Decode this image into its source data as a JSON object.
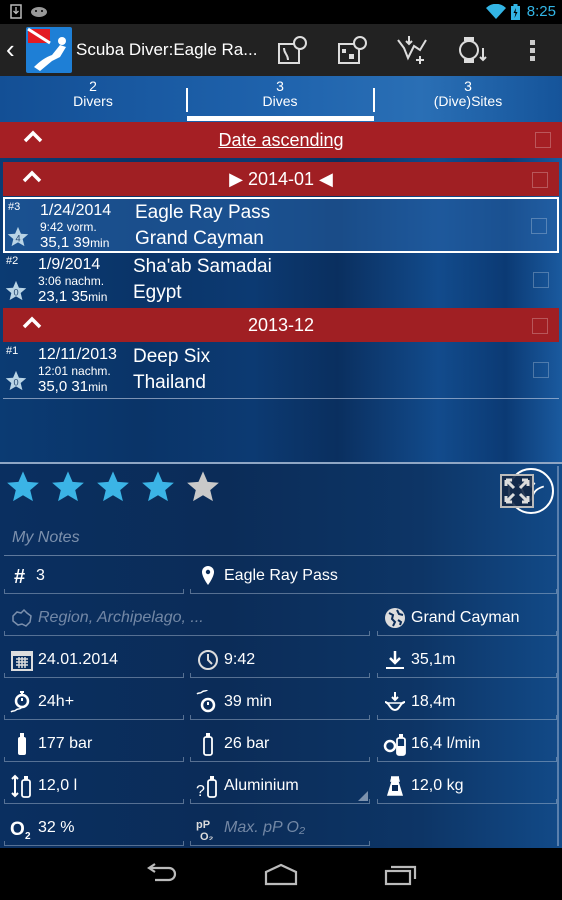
{
  "status_bar": {
    "time": "8:25",
    "icons": [
      "download-icon",
      "android-icon",
      "wifi-icon",
      "battery-charging-icon"
    ]
  },
  "action_bar": {
    "title": "Scuba Diver:Eagle Ra...",
    "actions": [
      "map-icon",
      "world-map-icon",
      "add-profile-icon",
      "dive-computer-icon",
      "overflow-menu-icon"
    ]
  },
  "tabs": [
    {
      "count": "2",
      "label": "Divers"
    },
    {
      "count": "3",
      "label": "Dives",
      "selected": true
    },
    {
      "count": "3",
      "label": "(Dive)Sites"
    }
  ],
  "sort": {
    "label": "Date ascending"
  },
  "groups": [
    {
      "label": "2014-01",
      "marker_left": "▶",
      "marker_right": "◀"
    },
    {
      "label": "2013-12"
    }
  ],
  "dives": [
    {
      "num": "#3",
      "date": "1/24/2014",
      "time": "9:42 vorm.",
      "depth": "35,1",
      "duration": "39",
      "unit": "min",
      "rating": "4",
      "site": "Eagle Ray Pass",
      "country": "Grand Cayman",
      "selected": true
    },
    {
      "num": "#2",
      "date": "1/9/2014",
      "time": "3:06 nachm.",
      "depth": "23,1",
      "duration": "35",
      "unit": "min",
      "rating": "0",
      "site": "Sha'ab Samadai",
      "country": "Egypt"
    },
    {
      "num": "#1",
      "date": "12/11/2013",
      "time": "12:01 nachm.",
      "depth": "35,0",
      "duration": "31",
      "unit": "min",
      "rating": "0",
      "site": "Deep Six",
      "country": "Thailand"
    }
  ],
  "detail": {
    "rating": 4,
    "rating_max": 5,
    "notes_placeholder": "My Notes",
    "dive_number": "3",
    "site": "Eagle Ray Pass",
    "region_placeholder": "Region, Archipelago, ...",
    "country": "Grand Cayman",
    "date": "24.01.2014",
    "time": "9:42",
    "max_depth": "35,1m",
    "surface_interval": "24h+",
    "duration": "39 min",
    "avg_depth": "18,4m",
    "start_pressure": "177 bar",
    "end_pressure": "26 bar",
    "sac_rate": "16,4 l/min",
    "tank_volume": "12,0 l",
    "tank_material": "Aluminium",
    "weight": "12,0 kg",
    "o2_label": "O",
    "o2_sub": "2",
    "o2_percent": "32 %",
    "max_ppo2_placeholder": "Max. pP O₂"
  },
  "colors": {
    "accent_red": "#a01f23",
    "star_filled": "#3bb4e6",
    "star_empty": "#c9c9c9",
    "status_time": "#33b5e5"
  }
}
